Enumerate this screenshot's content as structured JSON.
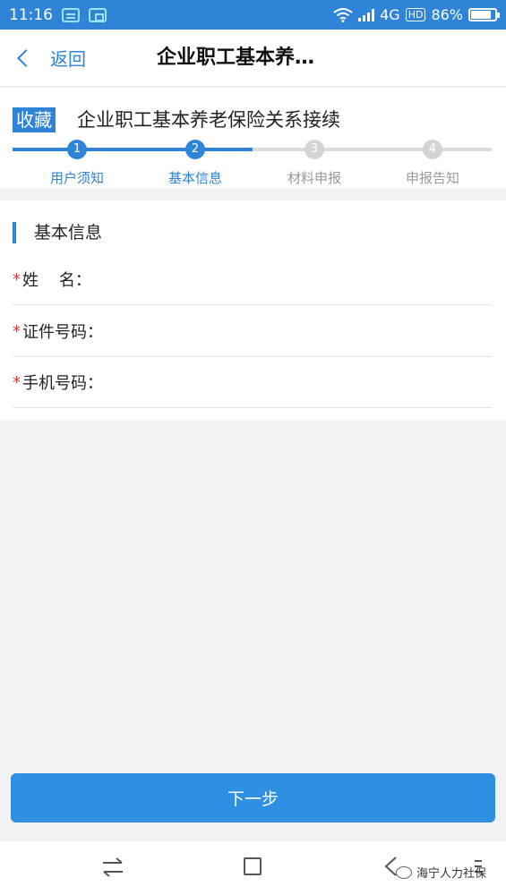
{
  "status_bar": {
    "time": "11:16",
    "network": "4G",
    "hd": "HD",
    "battery": "86%",
    "battery_level": 0.86,
    "icons": [
      "message-icon",
      "scan-icon",
      "wifi-icon",
      "signal-icon",
      "battery-icon"
    ]
  },
  "nav": {
    "back_label": "返回",
    "title": "企业职工基本养…"
  },
  "service": {
    "favorite_label": "收藏",
    "title": "企业职工基本养老保险关系接续"
  },
  "steps": [
    {
      "number": "1",
      "label": "用户须知",
      "state": "done"
    },
    {
      "number": "2",
      "label": "基本信息",
      "state": "done"
    },
    {
      "number": "3",
      "label": "材料申报",
      "state": "todo"
    },
    {
      "number": "4",
      "label": "申报告知",
      "state": "todo"
    }
  ],
  "form": {
    "section_title": "基本信息",
    "required_mark": "*",
    "fields": [
      {
        "label": "姓    名：",
        "value": ""
      },
      {
        "label": "证件号码：",
        "value": ""
      },
      {
        "label": "手机号码：",
        "value": ""
      }
    ]
  },
  "next_button_label": "下一步",
  "watermark": "海宁人力社保",
  "colors": {
    "primary": "#2f84d8",
    "required": "#e23a3a",
    "inactive": "#d4d4d4"
  }
}
